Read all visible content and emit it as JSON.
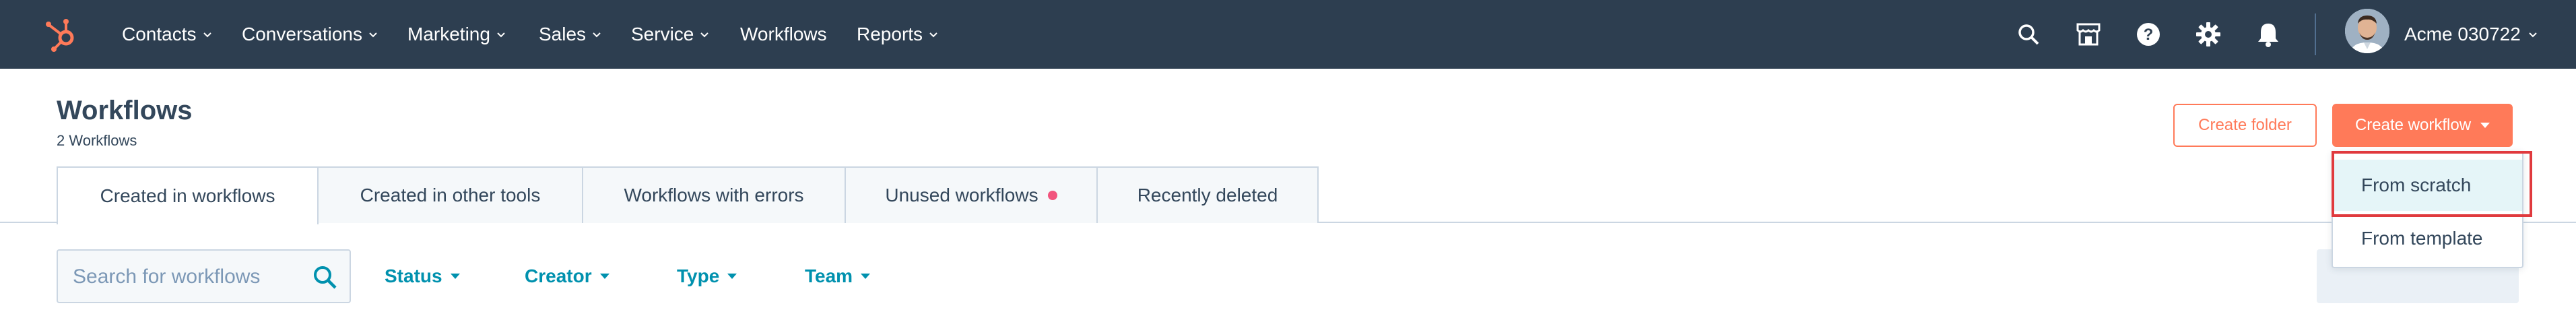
{
  "nav": {
    "items": [
      {
        "label": "Contacts",
        "has_menu": true
      },
      {
        "label": "Conversations",
        "has_menu": true
      },
      {
        "label": "Marketing",
        "has_menu": true
      },
      {
        "label": "Sales",
        "has_menu": true
      },
      {
        "label": "Service",
        "has_menu": true
      },
      {
        "label": "Workflows",
        "has_menu": false
      },
      {
        "label": "Reports",
        "has_menu": true
      }
    ],
    "icons": [
      "search-icon",
      "marketplace-icon",
      "help-icon",
      "settings-icon",
      "notifications-icon"
    ],
    "account_name": "Acme 030722"
  },
  "header": {
    "title": "Workflows",
    "subtitle": "2 Workflows",
    "create_folder_label": "Create folder",
    "create_workflow_label": "Create workflow"
  },
  "tabs": [
    {
      "label": "Created in workflows",
      "active": true
    },
    {
      "label": "Created in other tools",
      "active": false
    },
    {
      "label": "Workflows with errors",
      "active": false
    },
    {
      "label": "Unused workflows",
      "active": false,
      "indicator": true
    },
    {
      "label": "Recently deleted",
      "active": false
    }
  ],
  "filters": {
    "search_placeholder": "Search for workflows",
    "items": [
      "Status",
      "Creator",
      "Type",
      "Team"
    ]
  },
  "dropdown": {
    "items": [
      "From scratch",
      "From template"
    ],
    "highlighted": "From scratch"
  },
  "colors": {
    "nav_bg": "#2d3e50",
    "accent": "#ff7a59",
    "link": "#0091ae",
    "highlight": "#e03a3e",
    "indicator": "#f2547d"
  }
}
